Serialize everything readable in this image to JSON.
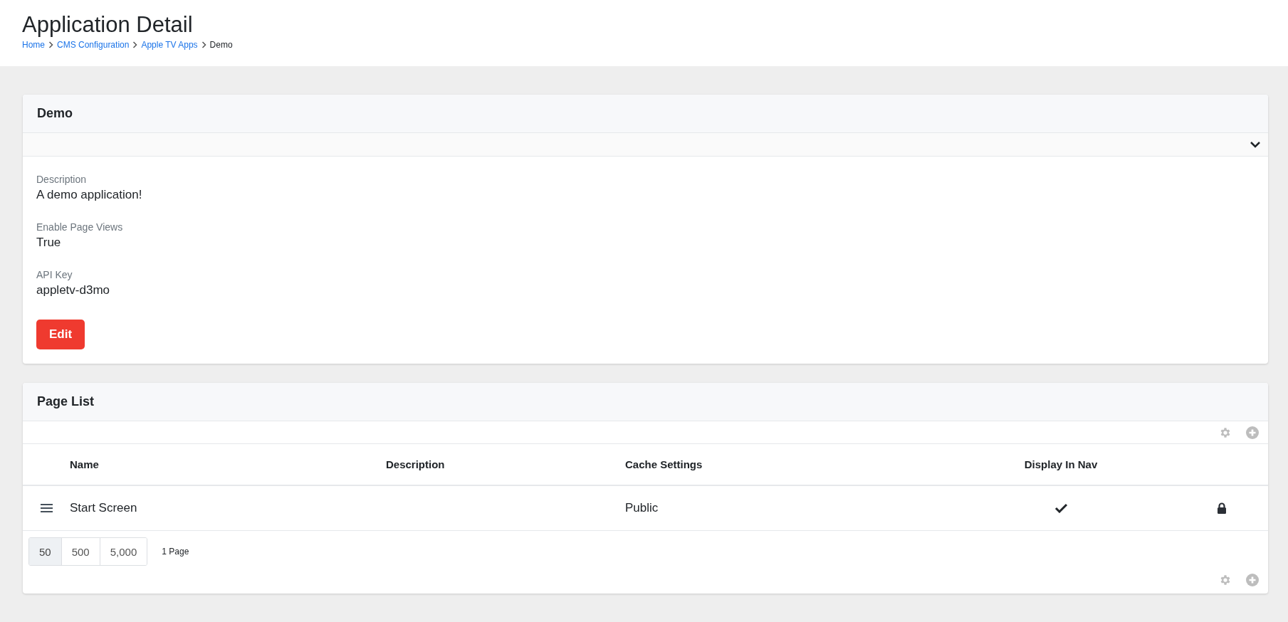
{
  "page_title": "Application Detail",
  "breadcrumb": [
    {
      "label": "Home",
      "link": true
    },
    {
      "label": "CMS Configuration",
      "link": true
    },
    {
      "label": "Apple TV Apps",
      "link": true
    },
    {
      "label": "Demo",
      "link": false
    }
  ],
  "detail_card": {
    "title": "Demo",
    "expanded": true,
    "fields": [
      {
        "label": "Description",
        "value": "A demo application!"
      },
      {
        "label": "Enable Page Views",
        "value": "True"
      },
      {
        "label": "API Key",
        "value": "appletv-d3mo"
      }
    ],
    "edit_button": "Edit"
  },
  "page_list": {
    "title": "Page List",
    "columns": [
      "Name",
      "Description",
      "Cache Settings",
      "Display In Nav"
    ],
    "rows": [
      {
        "name": "Start Screen",
        "description": "",
        "cache_settings": "Public",
        "display_in_nav": true,
        "locked": true
      }
    ],
    "page_sizes": [
      {
        "label": "50",
        "selected": true
      },
      {
        "label": "500",
        "selected": false
      },
      {
        "label": "5,000",
        "selected": false
      }
    ],
    "page_count": "1 Page"
  }
}
